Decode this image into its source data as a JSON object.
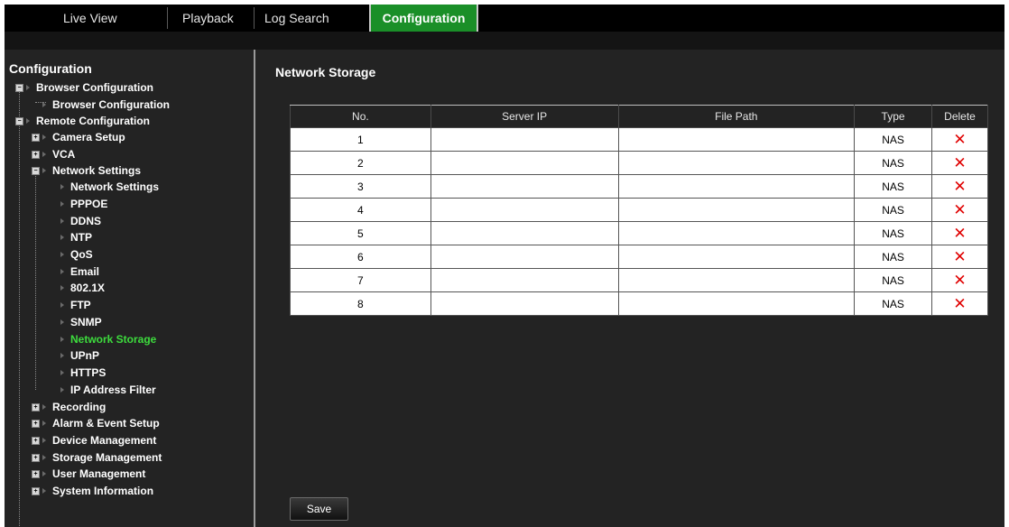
{
  "nav": {
    "tabs": [
      {
        "label": "Live View"
      },
      {
        "label": "Playback"
      },
      {
        "label": "Log Search"
      },
      {
        "label": "Configuration",
        "active": true
      }
    ]
  },
  "sidebar": {
    "title": "Configuration",
    "items": [
      {
        "label": "Browser Configuration",
        "toggle": "minus"
      },
      {
        "label": "Browser Configuration"
      },
      {
        "label": "Remote Configuration",
        "toggle": "minus"
      },
      {
        "label": "Camera Setup",
        "toggle": "plus"
      },
      {
        "label": "VCA",
        "toggle": "plus"
      },
      {
        "label": "Network Settings",
        "toggle": "minus"
      },
      {
        "label": "Network Settings"
      },
      {
        "label": "PPPOE"
      },
      {
        "label": "DDNS"
      },
      {
        "label": "NTP"
      },
      {
        "label": "QoS"
      },
      {
        "label": "Email"
      },
      {
        "label": "802.1X"
      },
      {
        "label": "FTP"
      },
      {
        "label": "SNMP"
      },
      {
        "label": "Network Storage",
        "selected": true
      },
      {
        "label": "UPnP"
      },
      {
        "label": "HTTPS"
      },
      {
        "label": "IP Address Filter"
      },
      {
        "label": "Recording",
        "toggle": "plus"
      },
      {
        "label": "Alarm & Event Setup",
        "toggle": "plus"
      },
      {
        "label": "Device Management",
        "toggle": "plus"
      },
      {
        "label": "Storage Management",
        "toggle": "plus"
      },
      {
        "label": "User Management",
        "toggle": "plus"
      },
      {
        "label": "System Information",
        "toggle": "plus"
      }
    ]
  },
  "main": {
    "title": "Network Storage",
    "table": {
      "columns": [
        "No.",
        "Server IP",
        "File Path",
        "Type",
        "Delete"
      ],
      "rows": [
        {
          "no": "1",
          "server_ip": "",
          "file_path": "",
          "type": "NAS",
          "delete": "✕"
        },
        {
          "no": "2",
          "server_ip": "",
          "file_path": "",
          "type": "NAS",
          "delete": "✕"
        },
        {
          "no": "3",
          "server_ip": "",
          "file_path": "",
          "type": "NAS",
          "delete": "✕"
        },
        {
          "no": "4",
          "server_ip": "",
          "file_path": "",
          "type": "NAS",
          "delete": "✕"
        },
        {
          "no": "5",
          "server_ip": "",
          "file_path": "",
          "type": "NAS",
          "delete": "✕"
        },
        {
          "no": "6",
          "server_ip": "",
          "file_path": "",
          "type": "NAS",
          "delete": "✕"
        },
        {
          "no": "7",
          "server_ip": "",
          "file_path": "",
          "type": "NAS",
          "delete": "✕"
        },
        {
          "no": "8",
          "server_ip": "",
          "file_path": "",
          "type": "NAS",
          "delete": "✕"
        }
      ]
    },
    "save_label": "Save"
  },
  "colors": {
    "active_tab": "#1a8f28",
    "selected_item": "#3ddc3d",
    "delete_icon": "#e00000",
    "background": "#232323"
  }
}
